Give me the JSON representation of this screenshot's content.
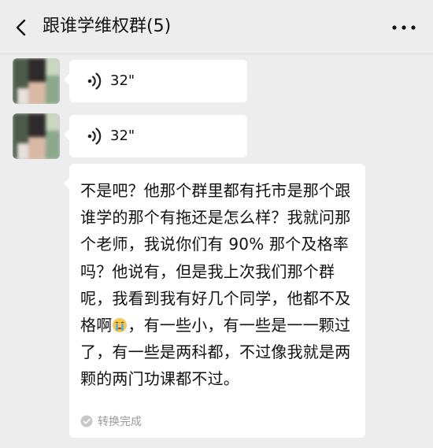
{
  "header": {
    "back_icon": "chevron-left-icon",
    "title": "跟谁学维权群(5)",
    "more_icon": "more-dots-icon"
  },
  "messages": [
    {
      "type": "voice",
      "sender_avatar": "blurred-avatar",
      "duration": "32\"",
      "icon": "voice-wave-icon"
    },
    {
      "type": "voice",
      "sender_avatar": "blurred-avatar",
      "duration": "32\"",
      "icon": "voice-wave-icon"
    },
    {
      "type": "transcript",
      "text_before_emoji": "不是吧？他那个群里都有托市是那个跟谁学的那个有拖还是怎么样？我就问那个老师，我说你们有 90% 那个及格率吗？他说有，但是我上次我们那个群呢，我看到我有好几个同学，他都不及格啊",
      "emoji": "crying-face-emoji",
      "text_after_emoji": "，有一些小，有一些是一一颗过了，有一些是两科都，不过像我就是两颗的两门功课都不过。",
      "status": "转换完成",
      "status_icon": "check-circle-icon"
    }
  ],
  "colors": {
    "background": "#ededed",
    "bubble": "#ffffff",
    "status_text": "#9a9a9a"
  }
}
